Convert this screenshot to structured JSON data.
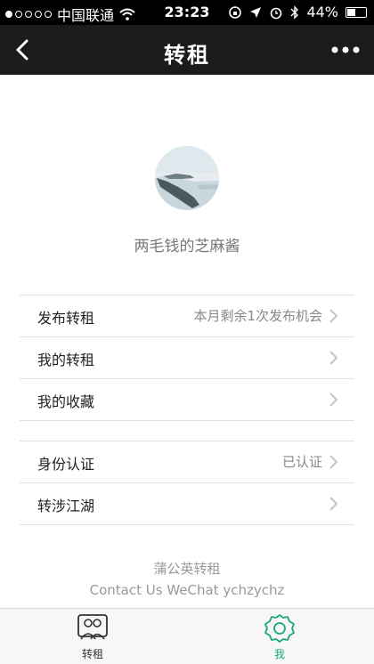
{
  "status_bar": {
    "carrier": "中国联通",
    "time": "23:23",
    "battery_percent": "44%",
    "battery_level": 0.44
  },
  "nav": {
    "title": "转租"
  },
  "profile": {
    "username": "两毛钱的芝麻酱"
  },
  "menu_group_1": [
    {
      "label": "发布转租",
      "value": "本月剩余1次发布机会"
    },
    {
      "label": "我的转租",
      "value": ""
    },
    {
      "label": "我的收藏",
      "value": ""
    }
  ],
  "menu_group_2": [
    {
      "label": "身份认证",
      "value": "已认证"
    },
    {
      "label": "转涉江湖",
      "value": ""
    }
  ],
  "footer": {
    "title": "蒲公英转租",
    "contact": "Contact Us WeChat ychzychz"
  },
  "tabs": [
    {
      "label": "转租",
      "icon": "people-icon",
      "active": false
    },
    {
      "label": "我",
      "icon": "gear-icon",
      "active": true
    }
  ],
  "colors": {
    "accent": "#1aa87e",
    "nav_background": "#1c1c1c",
    "tab_inactive": "#333333"
  }
}
